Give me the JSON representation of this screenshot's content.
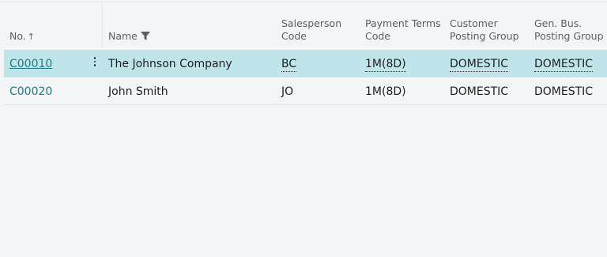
{
  "columns": {
    "no": "No.",
    "no_sort": "↑",
    "name": "Name",
    "salesperson_line1": "Salesperson",
    "salesperson_line2": "Code",
    "payterms_line1": "Payment Terms",
    "payterms_line2": "Code",
    "custgroup_line1": "Customer",
    "custgroup_line2": "Posting Group",
    "genbus_line1": "Gen. Bus.",
    "genbus_line2": "Posting Group"
  },
  "rows": [
    {
      "no": "C00010",
      "name": "The Johnson Company",
      "salesperson": "BC",
      "payterms": "1M(8D)",
      "custgroup": "DOMESTIC",
      "genbus": "DOMESTIC"
    },
    {
      "no": "C00020",
      "name": "John Smith",
      "salesperson": "JO",
      "payterms": "1M(8D)",
      "custgroup": "DOMESTIC",
      "genbus": "DOMESTIC"
    }
  ],
  "colors": {
    "selected_row": "#bfe5ea",
    "link": "#1d7b86"
  },
  "icons": {
    "filter": "filter-icon",
    "more": "more-options-icon",
    "sort": "sort-ascending-icon"
  }
}
